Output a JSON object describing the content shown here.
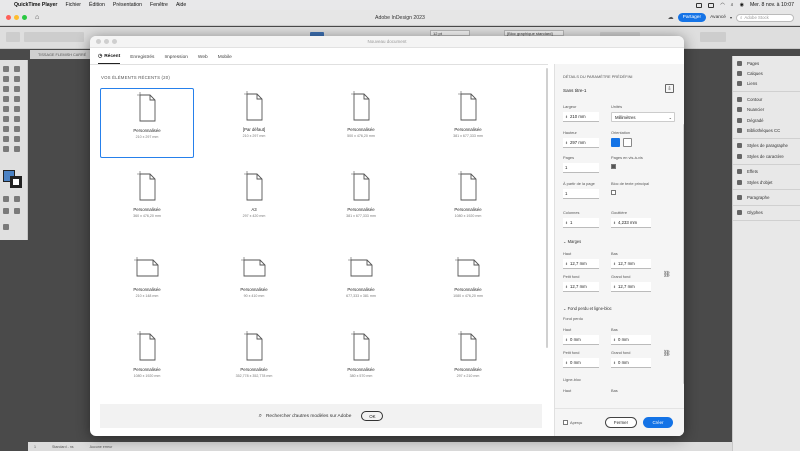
{
  "menubar": {
    "app": "QuickTime Player",
    "items": [
      "Fichier",
      "Édition",
      "Présentation",
      "Fenêtre",
      "Aide"
    ],
    "clock": "Mer. 8 nov. à 10:07"
  },
  "appbar": {
    "title": "Adobe InDesign 2023",
    "share": "Partager",
    "workspace": "Avancé",
    "stock_placeholder": "Adobe Stock"
  },
  "control_bar": {
    "zoom": "12 pt",
    "style": "[Bloc graphique standard]"
  },
  "doc_tab": "TISSAGE FLEMISH CARRÉ",
  "status": {
    "page": "1",
    "style": "Standard - ns",
    "errors": "Aucune erreur"
  },
  "panels": {
    "groups": [
      [
        "Pages",
        "Calques",
        "Liens"
      ],
      [
        "Contour",
        "Nuancier",
        "Dégradé",
        "Bibliothèques CC"
      ],
      [
        "Styles de paragraphe",
        "Styles de caractère"
      ],
      [
        "Effets",
        "Styles d'objet"
      ],
      [
        "Paragraphe"
      ],
      [
        "Glyphes"
      ]
    ]
  },
  "dialog": {
    "title": "Nouveau document",
    "tabs": [
      "Récent",
      "Enregistrés",
      "Impression",
      "Web",
      "Mobile"
    ],
    "recent_title": "VOS ÉLÉMENTS RÉCENTS (20)",
    "presets": [
      {
        "name": "Personnalisée",
        "size": "210 x 297 mm",
        "orientation": "portrait",
        "selected": true
      },
      {
        "name": "[Par défaut]",
        "size": "210 x 297 mm",
        "orientation": "portrait"
      },
      {
        "name": "Personnalisée",
        "size": "500 x 476,20 mm",
        "orientation": "portrait"
      },
      {
        "name": "Personnalisée",
        "size": "381 x 677,333 mm",
        "orientation": "portrait"
      },
      {
        "name": "Personnalisée",
        "size": "360 x 476,20 mm",
        "orientation": "portrait"
      },
      {
        "name": "A3",
        "size": "297 x 420 mm",
        "orientation": "portrait"
      },
      {
        "name": "Personnalisée",
        "size": "381 x 677,333 mm",
        "orientation": "portrait"
      },
      {
        "name": "Personnalisée",
        "size": "1080 x 1920 mm",
        "orientation": "portrait"
      },
      {
        "name": "Personnalisée",
        "size": "210 x 148 mm",
        "orientation": "landscape"
      },
      {
        "name": "Personnalisée",
        "size": "90 x 410 mm",
        "orientation": "landscape"
      },
      {
        "name": "Personnalisée",
        "size": "677,333 x 381 mm",
        "orientation": "landscape"
      },
      {
        "name": "Personnalisée",
        "size": "1080 x 476,20 mm",
        "orientation": "landscape"
      },
      {
        "name": "Personnalisée",
        "size": "1080 x 1920 mm",
        "orientation": "portrait"
      },
      {
        "name": "Personnalisée",
        "size": "352,778 x 352,778 mm",
        "orientation": "portrait"
      },
      {
        "name": "Personnalisée",
        "size": "380 x 570 mm",
        "orientation": "portrait"
      },
      {
        "name": "Personnalisée",
        "size": "297 x 210 mm",
        "orientation": "portrait"
      }
    ],
    "search_label": "Rechercher d'autres modèles sur Adobe",
    "ok": "OK",
    "details": {
      "header": "DÉTAILS DU PARAMÈTRE PRÉDÉFINI",
      "preset_name": "Sans titre-1",
      "width_label": "Largeur",
      "width": "210 mm",
      "units_label": "Unités",
      "units": "Millimètres",
      "height_label": "Hauteur",
      "height": "297 mm",
      "orientation_label": "Orientation",
      "pages_label": "Pages",
      "pages": "1",
      "facing_label": "Pages en vis-à-vis",
      "start_label": "À partir de la page",
      "start": "1",
      "text_frame_label": "Bloc de texte principal",
      "columns_label": "Colonnes",
      "columns": "1",
      "gutter_label": "Gouttière",
      "gutter": "4,233 mm",
      "margins_label": "Marges",
      "top_label": "Haut",
      "top": "12,7 mm",
      "bottom_label": "Bas",
      "bottom": "12,7 mm",
      "inside_label": "Petit fond",
      "inside": "12,7 mm",
      "outside_label": "Grand fond",
      "outside": "12,7 mm",
      "bleed_section": "Fond perdu et ligne-bloc",
      "bleed_label": "Fond perdu",
      "b_top_label": "Haut",
      "b_top": "0 mm",
      "b_bottom_label": "Bas",
      "b_bottom": "0 mm",
      "b_inside_label": "Petit fond",
      "b_inside": "0 mm",
      "b_outside_label": "Grand fond",
      "b_outside": "0 mm",
      "slug_label": "Ligne-bloc",
      "s_top_label": "Haut",
      "s_bottom_label": "Bas",
      "preview_label": "Aperçu",
      "close": "Fermer",
      "create": "Créer"
    }
  },
  "colors": {
    "accent": "#1473e6",
    "selection": "#2680eb"
  }
}
